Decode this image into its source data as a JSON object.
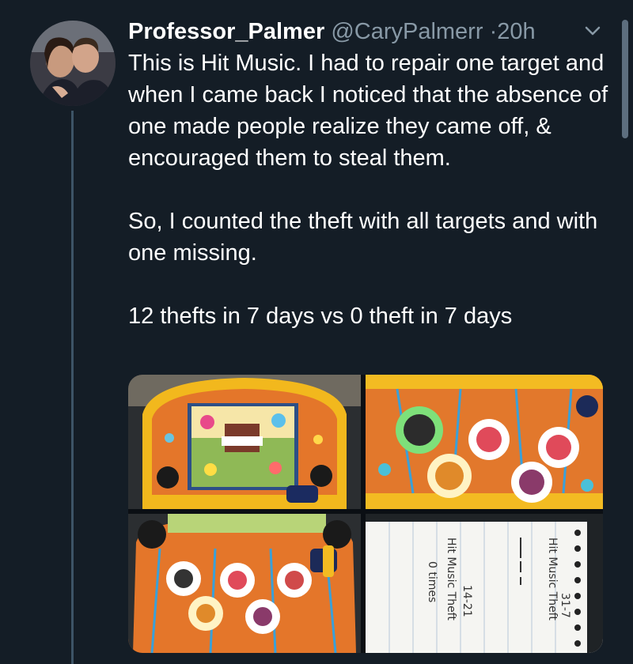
{
  "tweet": {
    "author_name": "Professor_Palmer",
    "author_handle": "@CaryPalmerr",
    "separator": "·",
    "timestamp": "20h",
    "paragraphs": [
      "This is Hit Music. I had to repair one target and when I came back I noticed that the absence of one made people realize they came off, & encouraged them to steal them.",
      "So, I counted the theft with all targets and with one missing.",
      "12 thefts in 7 days vs 0 theft in 7 days"
    ]
  },
  "icons": {
    "avatar": "profile-photo",
    "menu": "chevron-down-icon"
  },
  "media": {
    "notepad_text": [
      "Hit Music Theft",
      "31-7",
      "Hit Music Theft",
      "14-21",
      "0 times"
    ]
  },
  "colors": {
    "background": "#141d26",
    "text_primary": "#ffffff",
    "text_secondary": "#8899a6",
    "thread_line": "#3d5466"
  }
}
